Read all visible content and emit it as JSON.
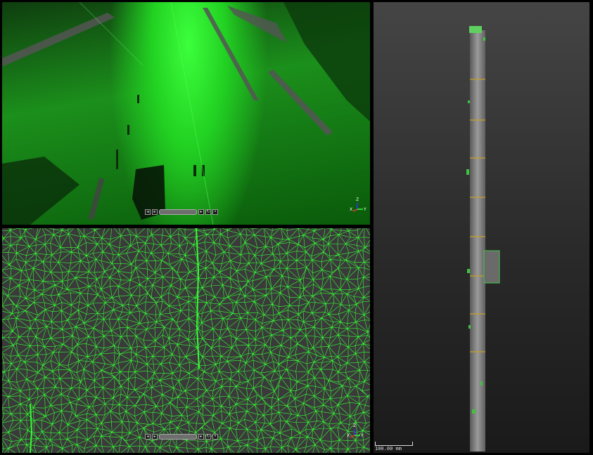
{
  "viewports": {
    "street": {
      "axes": {
        "x": "X",
        "y": "Y",
        "z": "Z"
      }
    },
    "mesh": {
      "axes": {
        "x": "X",
        "y": "Y",
        "z": "Z"
      }
    },
    "pole": {
      "scale_label": "100.00 mm"
    }
  },
  "navigation_bar": {
    "buttons": [
      "prev-icon",
      "next-icon",
      "play-icon",
      "loop-icon"
    ]
  },
  "colors": {
    "point_cloud_green": "#22e022",
    "mesh_line": "#33ff33",
    "mesh_background": "#3a3a3a",
    "pole_gray": "#8a8a8a",
    "ring_orange": "#c8a020"
  }
}
